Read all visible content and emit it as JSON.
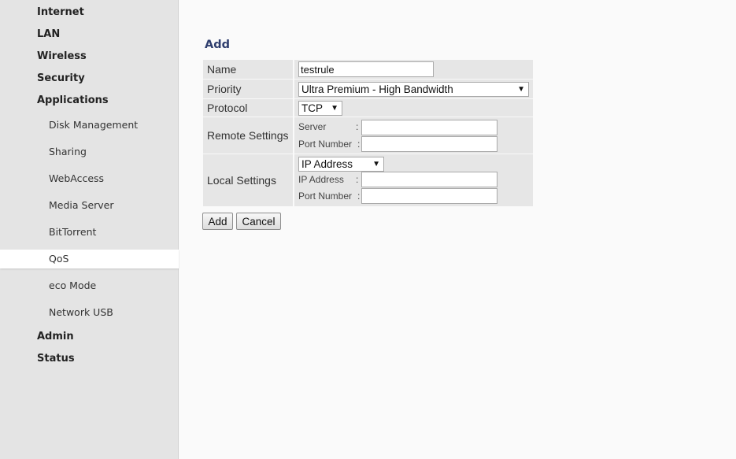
{
  "sidebar": {
    "top_items": [
      {
        "label": "Internet"
      },
      {
        "label": "LAN"
      },
      {
        "label": "Wireless"
      },
      {
        "label": "Security"
      },
      {
        "label": "Applications"
      }
    ],
    "sub_items": [
      {
        "label": "Disk Management"
      },
      {
        "label": "Sharing"
      },
      {
        "label": "WebAccess"
      },
      {
        "label": "Media Server"
      },
      {
        "label": "BitTorrent"
      },
      {
        "label": "QoS"
      },
      {
        "label": "eco Mode"
      },
      {
        "label": "Network USB"
      }
    ],
    "bottom_items": [
      {
        "label": "Admin"
      },
      {
        "label": "Status"
      }
    ],
    "active_item": "QoS"
  },
  "form": {
    "title": "Add",
    "name": {
      "label": "Name",
      "value": "testrule"
    },
    "priority": {
      "label": "Priority",
      "selected": "Ultra Premium - High Bandwidth"
    },
    "protocol": {
      "label": "Protocol",
      "selected": "TCP"
    },
    "remote": {
      "label": "Remote Settings",
      "server_label": "Server",
      "port_label": "Port Number",
      "colon": ":",
      "server_value": "",
      "port_value": ""
    },
    "local": {
      "label": "Local Settings",
      "type_selected": "IP Address",
      "ip_label": "IP Address",
      "port_label": "Port Number",
      "colon": ":",
      "ip_value": "",
      "port_value": ""
    },
    "buttons": {
      "add": "Add",
      "cancel": "Cancel"
    },
    "dropdown_arrow": "▼"
  },
  "colors": {
    "sidebar_bg": "#e4e4e4",
    "active_bg": "#ffffff",
    "heading": "#2f3e6e",
    "row_bg": "#e6e6e6"
  }
}
